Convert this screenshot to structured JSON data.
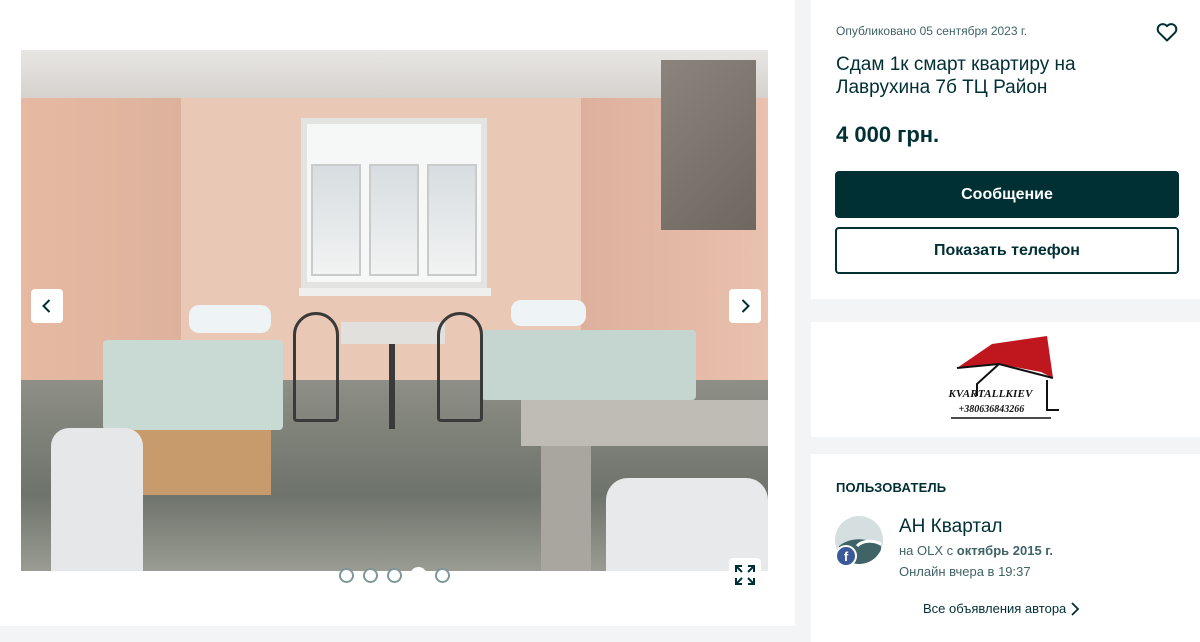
{
  "listing": {
    "published": "Опубликовано 05 сентября 2023 г.",
    "title": "Сдам 1к смарт квартиру на Лаврухина 7б ТЦ Район",
    "price": "4 000 грн."
  },
  "actions": {
    "message_label": "Сообщение",
    "phone_label": "Показать телефон"
  },
  "gallery": {
    "dots_count": 5,
    "active_dot": 4
  },
  "logo": {
    "line1": "KVARTALLKIEV",
    "line2": "+380636843266"
  },
  "user": {
    "heading": "ПОЛЬЗОВАТЕЛЬ",
    "name": "АН Квартал",
    "since_prefix": "на OLX с",
    "since_value": "октябрь 2015 г.",
    "online": "Онлайн вчера в 19:37",
    "all_ads": "Все объявления автора"
  },
  "icons": {
    "favorite": "heart-icon",
    "prev": "chevron-left-icon",
    "next": "chevron-right-icon",
    "fullscreen": "expand-icon",
    "social": "facebook-icon"
  },
  "colors": {
    "primary": "#002f34",
    "secondary_text": "#406367",
    "facebook": "#3b5998",
    "logo_red": "#c0161d"
  }
}
